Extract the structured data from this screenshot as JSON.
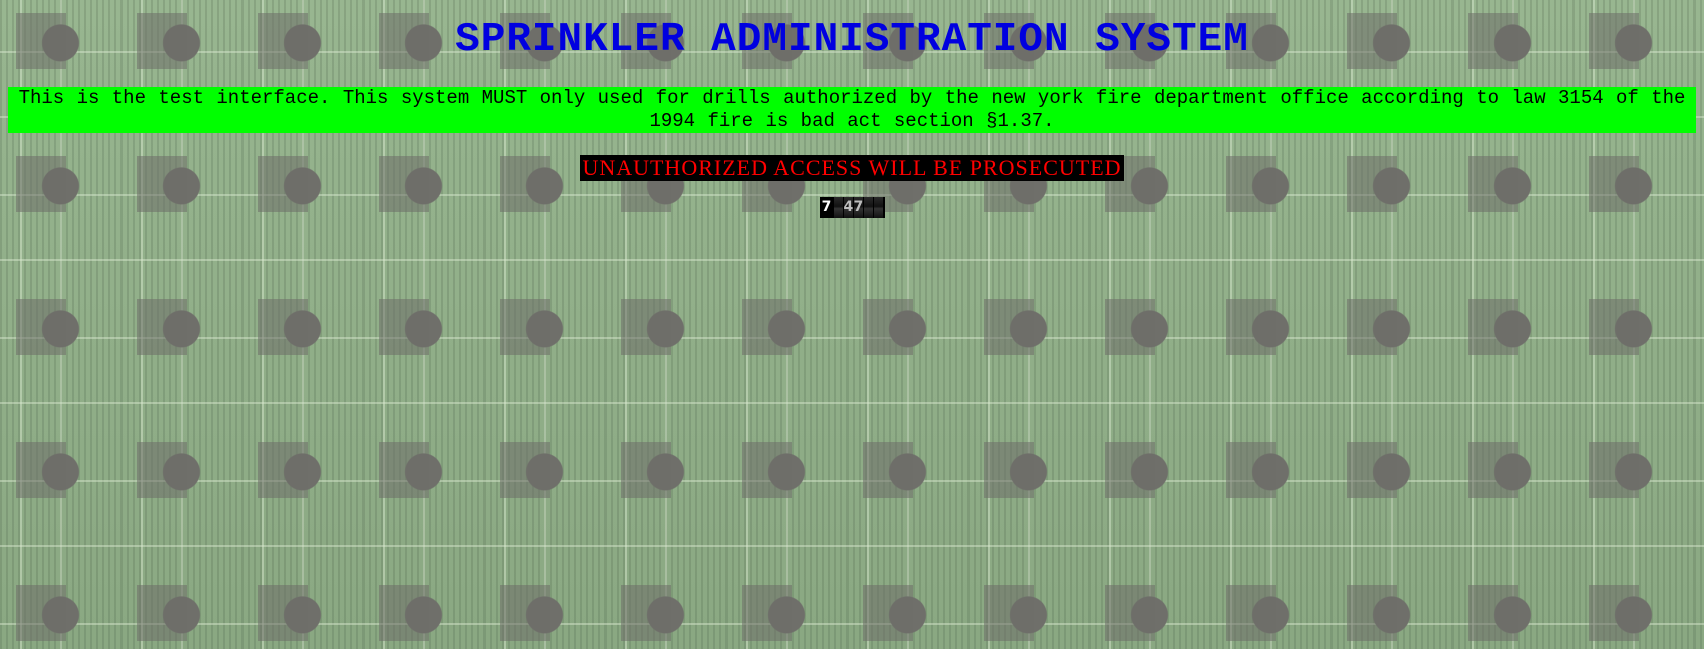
{
  "page": {
    "title": "SPRINKLER ADMINISTRATION SYSTEM",
    "notice": "This is the test interface. This system MUST only used for drills authorized by the new york fire department office according to law 3154 of the 1994 fire is bad act section §1.37.",
    "warning": "UNAUTHORIZED ACCESS WILL BE PROSECUTED"
  },
  "counter": {
    "digits": [
      "7",
      "",
      "4",
      "7",
      "",
      ""
    ]
  },
  "colors": {
    "title": "#0000e0",
    "notice_bg": "#00ff00",
    "warning_text": "#ff0000",
    "warning_bg": "#000000"
  }
}
